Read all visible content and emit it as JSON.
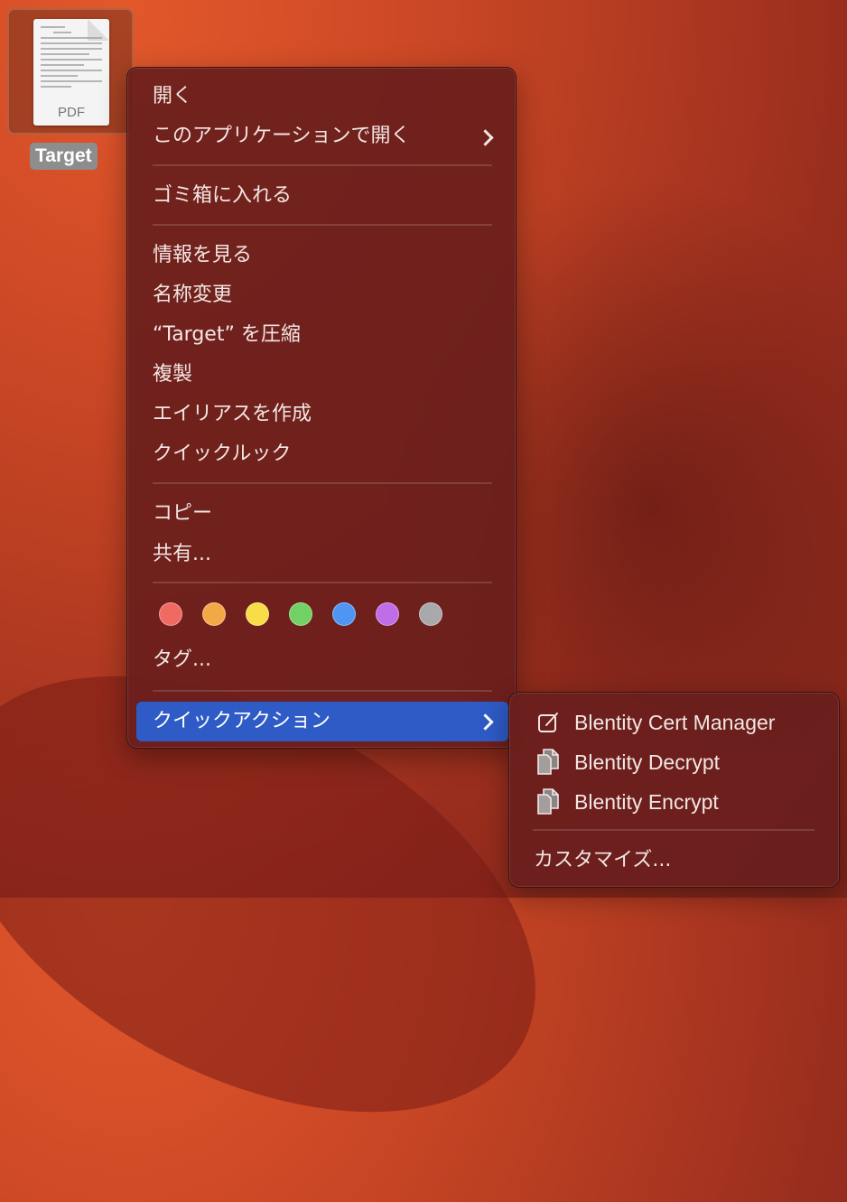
{
  "desktop": {
    "file": {
      "name": "Target",
      "thumbnail_label": "PDF"
    }
  },
  "context_menu": {
    "open": "開く",
    "open_with": "このアプリケーションで開く",
    "move_to_trash": "ゴミ箱に入れる",
    "get_info": "情報を見る",
    "rename": "名称変更",
    "compress": "“Target” を圧縮",
    "duplicate": "複製",
    "make_alias": "エイリアスを作成",
    "quick_look": "クイックルック",
    "copy": "コピー",
    "share": "共有...",
    "tags": "タグ...",
    "quick_actions": "クイックアクション",
    "tag_colors": [
      {
        "name": "red",
        "color": "#ef6b62"
      },
      {
        "name": "orange",
        "color": "#f3a848"
      },
      {
        "name": "yellow",
        "color": "#f8dc48"
      },
      {
        "name": "green",
        "color": "#72d164"
      },
      {
        "name": "blue",
        "color": "#4f96f4"
      },
      {
        "name": "purple",
        "color": "#c06ee8"
      },
      {
        "name": "gray",
        "color": "#a9a9ab"
      }
    ],
    "highlight_color": "#2e5bc6"
  },
  "quick_actions_submenu": {
    "items": [
      {
        "label": "Blentity Cert Manager",
        "icon": "edit-square-icon"
      },
      {
        "label": "Blentity Decrypt",
        "icon": "documents-icon"
      },
      {
        "label": "Blentity Encrypt",
        "icon": "documents-icon"
      }
    ],
    "customize": "カスタマイズ..."
  }
}
